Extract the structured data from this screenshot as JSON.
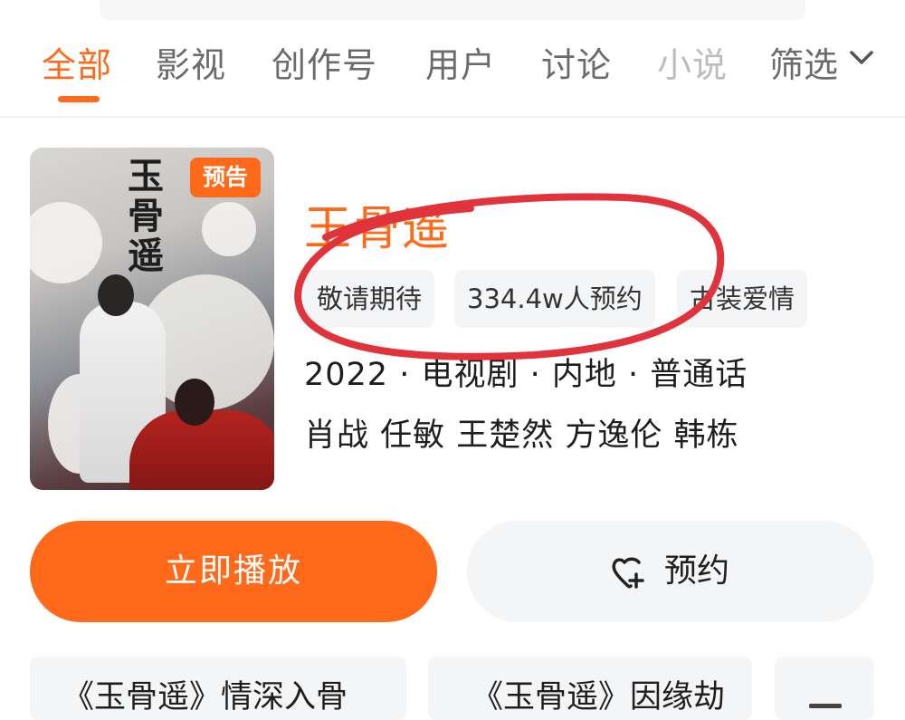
{
  "tabs": [
    {
      "label": "全部",
      "active": true
    },
    {
      "label": "影视",
      "active": false
    },
    {
      "label": "创作号",
      "active": false
    },
    {
      "label": "用户",
      "active": false
    },
    {
      "label": "讨论",
      "active": false
    },
    {
      "label": "小说",
      "active": false
    }
  ],
  "filter": {
    "label": "筛选",
    "icon": "chevron-down-icon"
  },
  "show": {
    "badge": "预告",
    "poster_calligraphy": "玉骨遥",
    "title": "玉骨遥",
    "tags": [
      "敬请期待",
      "334.4w人预约",
      "古装爱情"
    ],
    "meta": "2022 · 电视剧 · 内地 · 普通话",
    "cast": "肖战 任敏 王楚然 方逸伦 韩栋"
  },
  "actions": {
    "play_label": "立即播放",
    "reserve_label": "预约",
    "reserve_icon": "heart-plus-icon"
  },
  "related": [
    "《玉骨遥》情深入骨",
    "《玉骨遥》因缘劫"
  ],
  "colors": {
    "accent": "#ff6a1a",
    "annotation": "#e0333b",
    "chip_bg": "#f4f5f7"
  }
}
